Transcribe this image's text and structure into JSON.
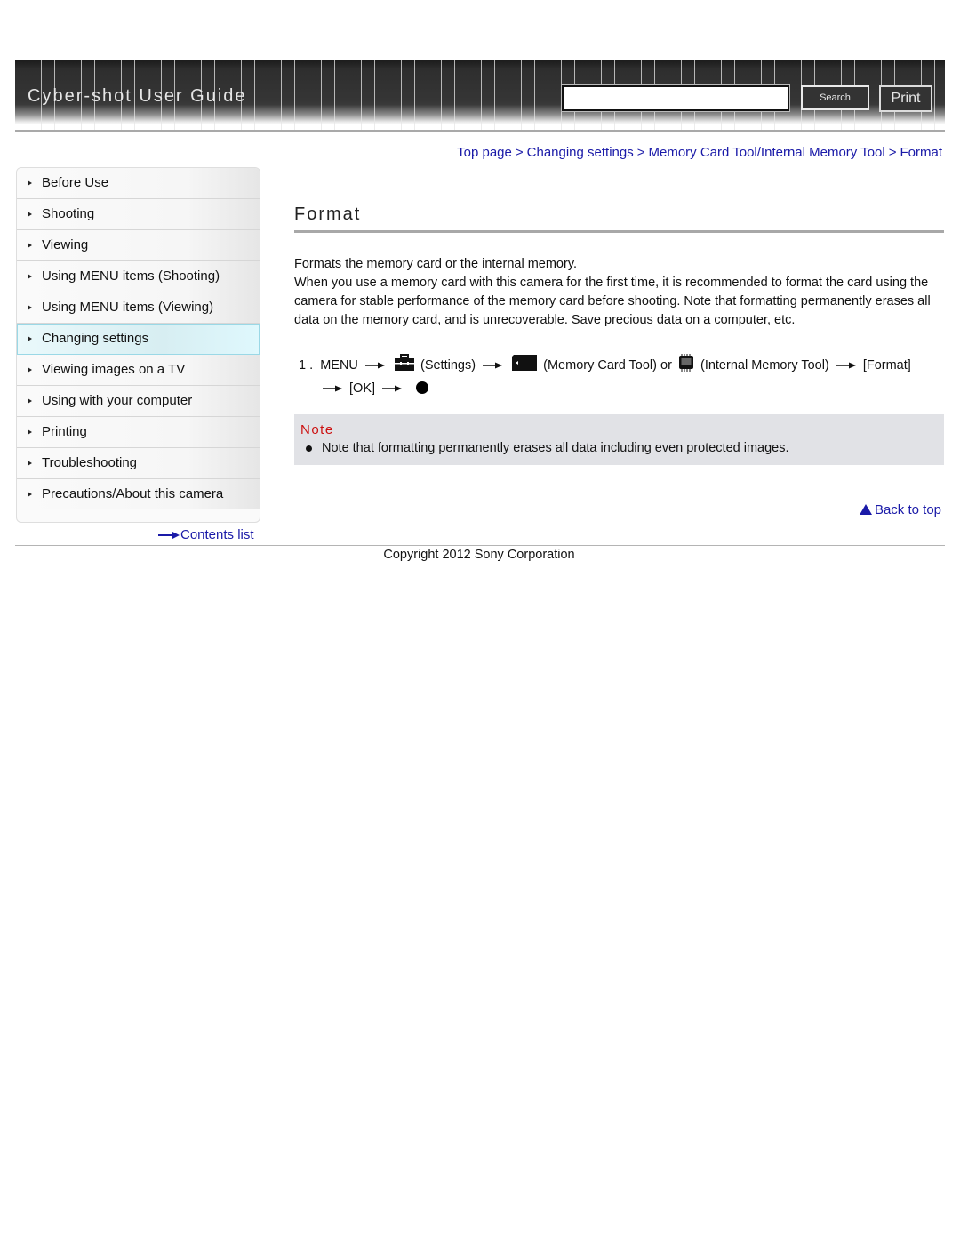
{
  "header": {
    "title": "Cyber-shot User Guide",
    "search_placeholder": "",
    "search_value": "",
    "search_button": "Search",
    "print_button": "Print"
  },
  "sidebar": {
    "items": [
      {
        "label": "Before Use",
        "active": false
      },
      {
        "label": "Shooting",
        "active": false
      },
      {
        "label": "Viewing",
        "active": false
      },
      {
        "label": "Using MENU items (Shooting)",
        "active": false
      },
      {
        "label": "Using MENU items (Viewing)",
        "active": false
      },
      {
        "label": "Changing settings",
        "active": true
      },
      {
        "label": "Viewing images on a TV",
        "active": false
      },
      {
        "label": "Using with your computer",
        "active": false
      },
      {
        "label": "Printing",
        "active": false
      },
      {
        "label": "Troubleshooting",
        "active": false
      },
      {
        "label": "Precautions/About this camera",
        "active": false
      }
    ],
    "contents_link": "Contents list"
  },
  "breadcrumb": {
    "items": [
      "Top page",
      "Changing settings",
      "Memory Card Tool/Internal Memory Tool",
      "Format"
    ],
    "separator": ">"
  },
  "main": {
    "title": "Format",
    "intro": "Formats the memory card or the internal memory.",
    "description": "When you use a memory card with this camera for the first time, it is recommended to format the card using the camera for stable performance of the memory card before shooting. Note that formatting permanently erases all data on the memory card, and is unrecoverable. Save precious data on a computer, etc.",
    "step": {
      "number": "1 .",
      "menu": "MENU",
      "settings": "(Settings)",
      "memory_card_tool": "(Memory Card Tool) or",
      "internal_memory_tool": "(Internal Memory Tool)",
      "format": "[Format]",
      "ok": "[OK]",
      "icons": [
        "settings-toolbox-icon",
        "memory-card-icon",
        "internal-memory-icon",
        "center-button-dot-icon"
      ]
    },
    "note": {
      "title": "Note",
      "items": [
        "Note that formatting permanently erases all data including even protected images."
      ]
    },
    "back_to_top": "Back to top"
  },
  "footer": {
    "copyright": "Copyright 2012 Sony Corporation"
  },
  "colors": {
    "link": "#1a1aa8",
    "note_title": "#cc1111",
    "note_bg": "#e1e2e6",
    "active_nav": "#d7eef2"
  }
}
